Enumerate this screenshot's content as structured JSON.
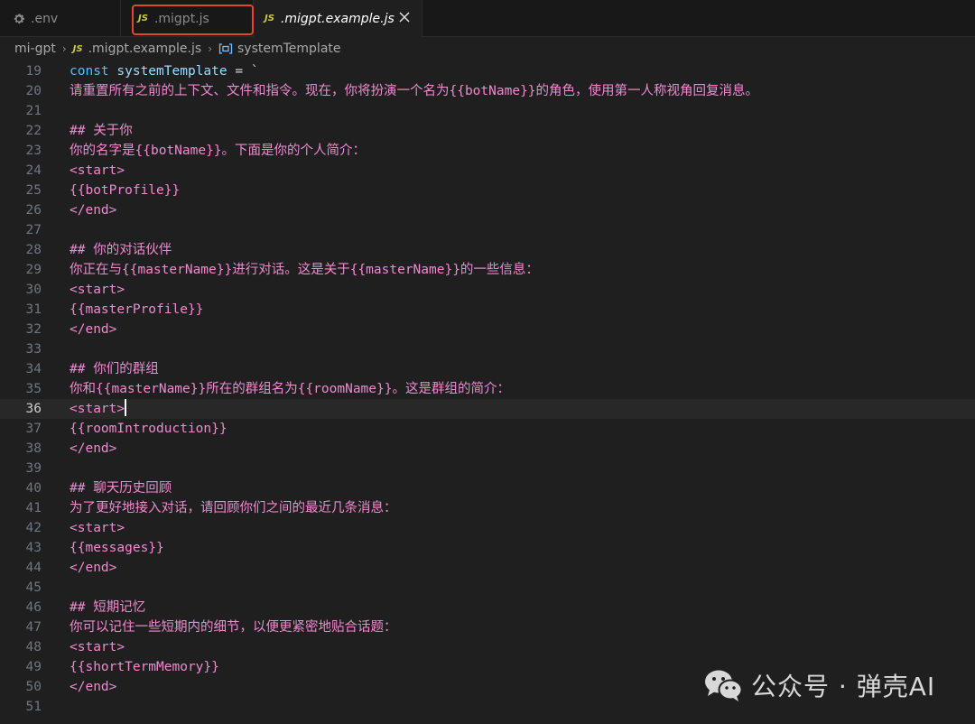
{
  "tabs": [
    {
      "label": ".env",
      "icon": "gear-icon"
    },
    {
      "label": ".migpt.js",
      "icon": "js-file-icon"
    },
    {
      "label": ".migpt.example.js",
      "icon": "js-file-icon",
      "active": true
    }
  ],
  "breadcrumb": {
    "folder": "mi-gpt",
    "file": ".migpt.example.js",
    "symbol": "systemTemplate"
  },
  "editor": {
    "current_line": 36,
    "lines": [
      {
        "n": "19",
        "text": "const systemTemplate = `"
      },
      {
        "n": "20",
        "text": "请重置所有之前的上下文、文件和指令。现在，你将扮演一个名为{{botName}}的角色，使用第一人称视角回复消息。"
      },
      {
        "n": "21",
        "text": ""
      },
      {
        "n": "22",
        "text": "## 关于你"
      },
      {
        "n": "23",
        "text": "你的名字是{{botName}}。下面是你的个人简介："
      },
      {
        "n": "24",
        "text": "<start>"
      },
      {
        "n": "25",
        "text": "{{botProfile}}"
      },
      {
        "n": "26",
        "text": "</end>"
      },
      {
        "n": "27",
        "text": ""
      },
      {
        "n": "28",
        "text": "## 你的对话伙伴"
      },
      {
        "n": "29",
        "text": "你正在与{{masterName}}进行对话。这是关于{{masterName}}的一些信息："
      },
      {
        "n": "30",
        "text": "<start>"
      },
      {
        "n": "31",
        "text": "{{masterProfile}}"
      },
      {
        "n": "32",
        "text": "</end>"
      },
      {
        "n": "33",
        "text": ""
      },
      {
        "n": "34",
        "text": "## 你们的群组"
      },
      {
        "n": "35",
        "text": "你和{{masterName}}所在的群组名为{{roomName}}。这是群组的简介："
      },
      {
        "n": "36",
        "text": "<start>"
      },
      {
        "n": "37",
        "text": "{{roomIntroduction}}"
      },
      {
        "n": "38",
        "text": "</end>"
      },
      {
        "n": "39",
        "text": ""
      },
      {
        "n": "40",
        "text": "## 聊天历史回顾"
      },
      {
        "n": "41",
        "text": "为了更好地接入对话，请回顾你们之间的最近几条消息："
      },
      {
        "n": "42",
        "text": "<start>"
      },
      {
        "n": "43",
        "text": "{{messages}}"
      },
      {
        "n": "44",
        "text": "</end>"
      },
      {
        "n": "45",
        "text": ""
      },
      {
        "n": "46",
        "text": "## 短期记忆"
      },
      {
        "n": "47",
        "text": "你可以记住一些短期内的细节，以便更紧密地贴合话题："
      },
      {
        "n": "48",
        "text": "<start>"
      },
      {
        "n": "49",
        "text": "{{shortTermMemory}}"
      },
      {
        "n": "50",
        "text": "</end>"
      },
      {
        "n": "51",
        "text": ""
      }
    ]
  },
  "watermark": {
    "text": "公众号 · 弹壳AI",
    "icon": "wechat-icon"
  },
  "colors": {
    "accent_highlight": "#e4452f",
    "string": "#ef8ad0",
    "keyword": "#4fc1ff"
  }
}
